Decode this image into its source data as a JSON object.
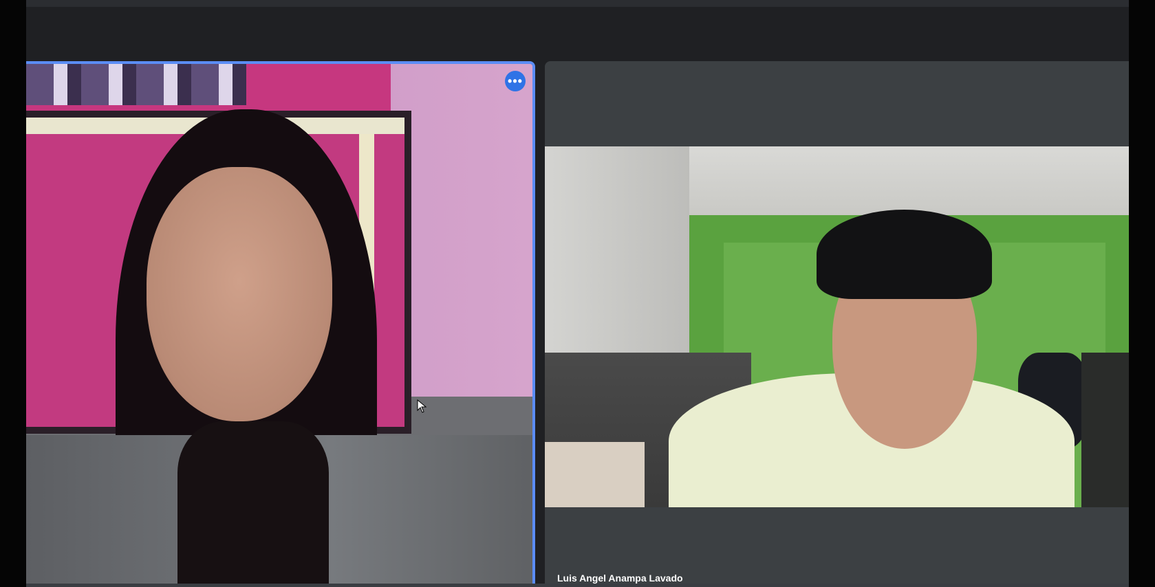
{
  "tiles": [
    {
      "id": "speaker",
      "name": "",
      "active_speaker": true,
      "more_options_label": "•••",
      "border_color": "#5b8df5"
    },
    {
      "id": "participant",
      "name": "Luis Angel Anampa Lavado",
      "active_speaker": false
    }
  ],
  "colors": {
    "background": "#1f2023",
    "tile_background": "#3c4043",
    "active_border": "#5b8df5",
    "more_button": "#2f73e6"
  },
  "icons": {
    "more_options": "more-horizontal-icon",
    "cursor": "mouse-pointer-icon"
  }
}
